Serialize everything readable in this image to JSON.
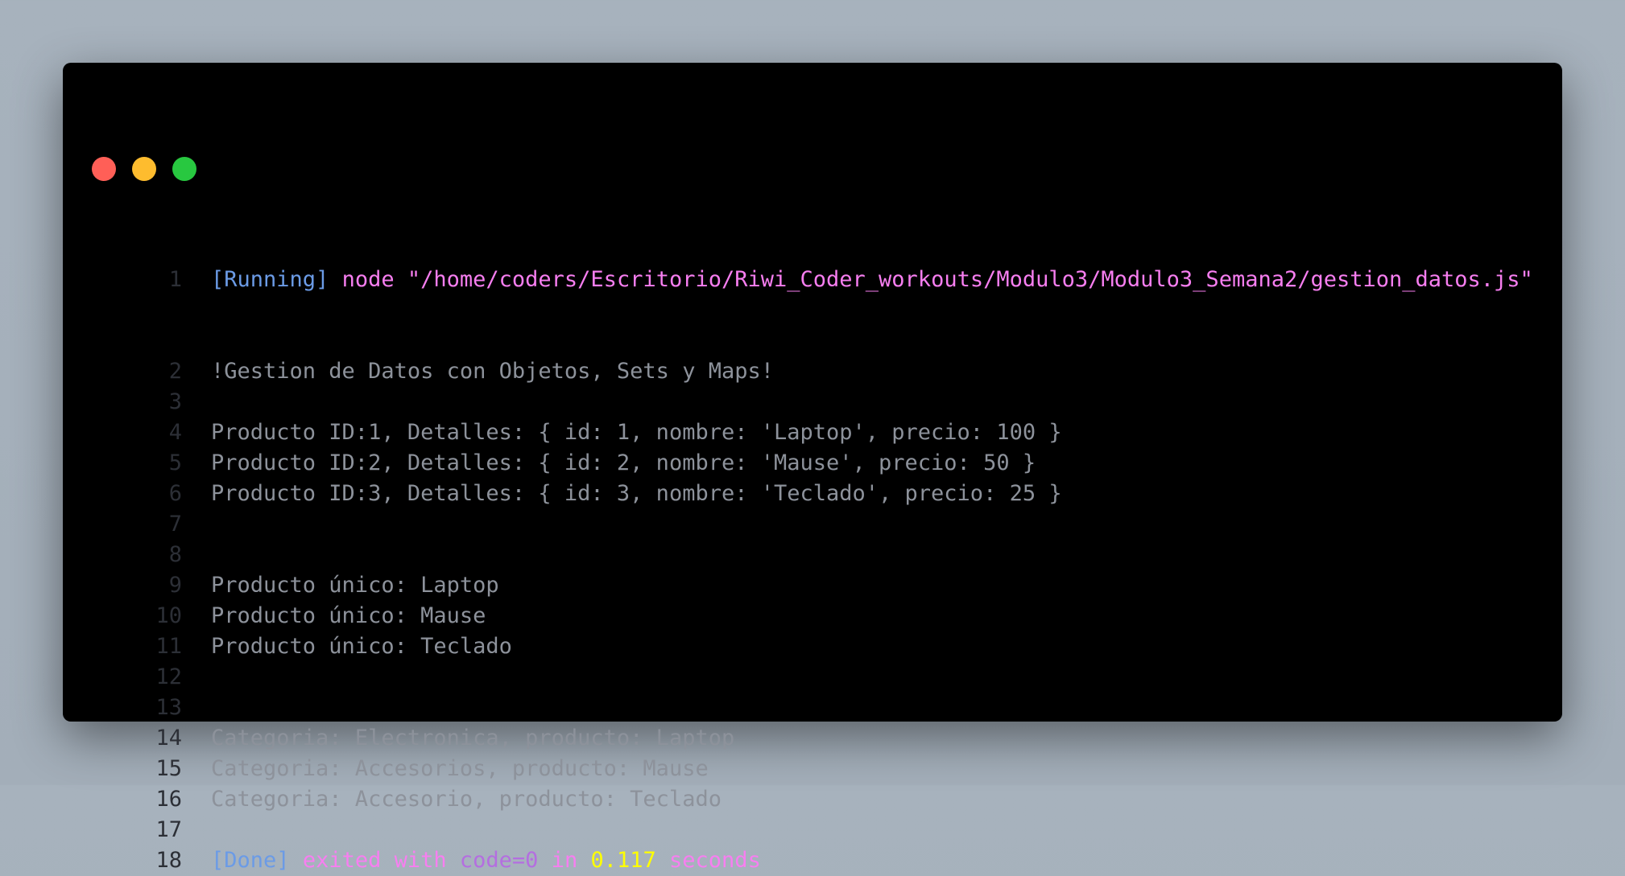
{
  "window_controls": {
    "close_color": "#ff5f57",
    "minimize_color": "#febc2e",
    "maximize_color": "#28c840"
  },
  "output": {
    "running_tag": "[Running]",
    "command": "node \"/home/coders/Escritorio/Riwi_Coder_workouts/Modulo3/Modulo3_Semana2/gestion_datos.js\"",
    "lines": [
      "!Gestion de Datos con Objetos, Sets y Maps!",
      "",
      "Producto ID:1, Detalles: { id: 1, nombre: 'Laptop', precio: 100 }",
      "Producto ID:2, Detalles: { id: 2, nombre: 'Mause', precio: 50 }",
      "Producto ID:3, Detalles: { id: 3, nombre: 'Teclado', precio: 25 }",
      "",
      "",
      "Producto único: Laptop",
      "Producto único: Mause",
      "Producto único: Teclado",
      "",
      "",
      "Categoria: Electronica, producto: Laptop",
      "Categoria: Accesorios, producto: Mause",
      "Categoria: Accesorio, producto: Teclado",
      ""
    ],
    "done_tag": "[Done]",
    "exited_with": "exited with",
    "code": "code=0",
    "in": "in",
    "duration": "0.117",
    "seconds": "seconds"
  },
  "line_numbers": [
    "1",
    "2",
    "3",
    "4",
    "5",
    "6",
    "7",
    "8",
    "9",
    "10",
    "11",
    "12",
    "13",
    "14",
    "15",
    "16",
    "17",
    "18"
  ]
}
